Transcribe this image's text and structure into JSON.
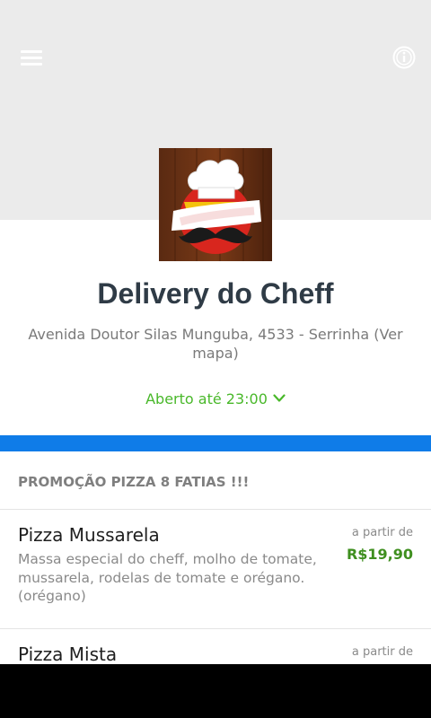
{
  "header": {
    "menu_icon": "hamburger-menu-icon",
    "info_icon": "info-circle-icon"
  },
  "store": {
    "logo": "delivery-do-cheff-logo",
    "name": "Delivery do Cheff",
    "address": "Avenida Doutor Silas Munguba, 4533 - Serrinha",
    "map_link": "(Ver mapa)",
    "hours": "Aberto até 23:00",
    "hours_icon": "chevron-down-icon"
  },
  "colors": {
    "header_bg": "#ebebeb",
    "accent_blue": "#0f7ce8",
    "open_green": "#49b82a",
    "price_green": "#3f8f1f"
  },
  "menu": {
    "section_title": "PROMOÇÃO PIZZA 8 FATIAS !!!",
    "items": [
      {
        "name": "Pizza Mussarela",
        "description": "Massa especial do cheff, molho de tomate, mussarela, rodelas de tomate e orégano. (orégano)",
        "from_label": "a partir de",
        "price": "R$19,90"
      },
      {
        "name": "Pizza Mista",
        "description": "",
        "from_label": "a partir de",
        "price": ""
      }
    ]
  }
}
